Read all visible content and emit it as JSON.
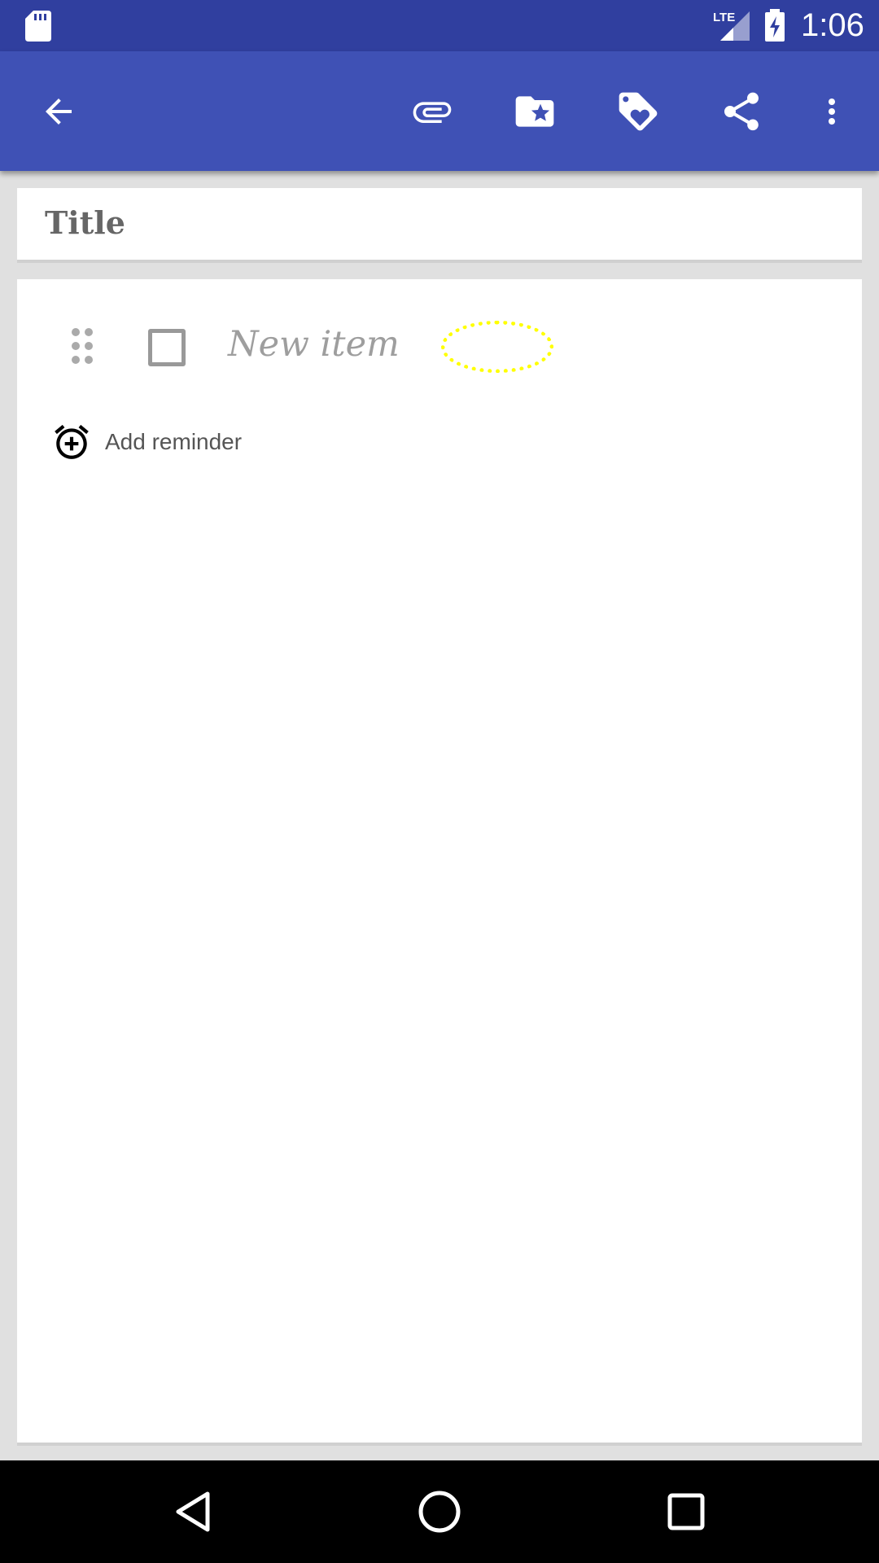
{
  "status_bar": {
    "time": "1:06",
    "network_label": "LTE",
    "icons": [
      "sd-card-icon",
      "lte-signal-icon",
      "battery-charging-icon"
    ]
  },
  "toolbar": {
    "icons": [
      "back-arrow-icon",
      "attachment-icon",
      "folder-star-icon",
      "tag-heart-icon",
      "share-icon",
      "more-vert-icon"
    ],
    "background_color": "#3f51b5"
  },
  "note": {
    "title": "Title"
  },
  "checklist": {
    "new_item_placeholder": "New item",
    "drag_icon": "drag-handle-icon"
  },
  "reminder": {
    "label": "Add reminder",
    "icon": "alarm-add-icon"
  },
  "nav_bar": {
    "icons": [
      "back-triangle-icon",
      "home-circle-icon",
      "recents-square-icon"
    ]
  },
  "colors": {
    "status_bar": "#303f9f",
    "toolbar": "#3f51b5",
    "annotation": "#ffff00"
  }
}
